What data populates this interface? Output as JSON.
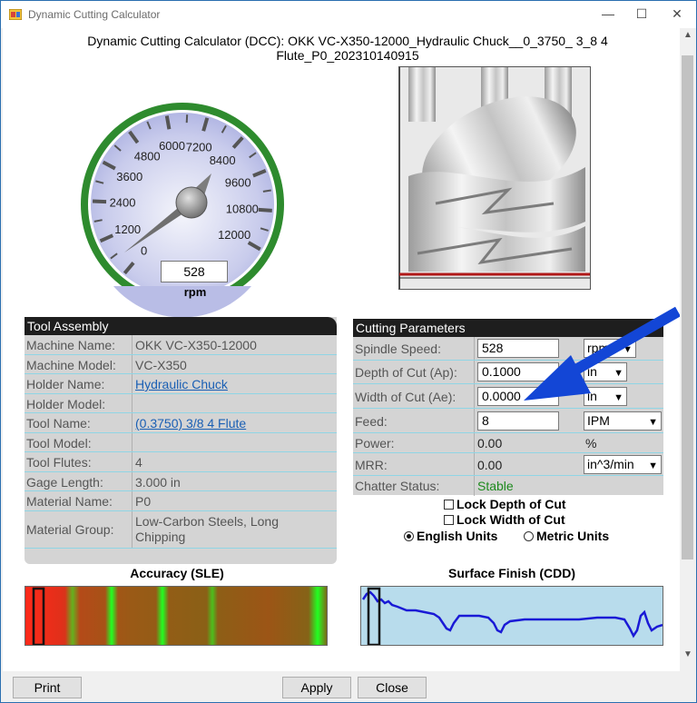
{
  "window": {
    "title": "Dynamic Cutting Calculator"
  },
  "header": {
    "title_line1": "Dynamic Cutting Calculator (DCC): OKK VC-X350-12000_Hydraulic Chuck__0_3750_ 3_8 4",
    "title_line2": "Flute_P0_202310140915"
  },
  "gauge": {
    "ticks": [
      "0",
      "1200",
      "2400",
      "3600",
      "4800",
      "6000",
      "7200",
      "8400",
      "9600",
      "10800",
      "12000"
    ],
    "value": "528",
    "needle_rpm": 528,
    "max_rpm": 12000,
    "unit": "rpm"
  },
  "tool_assembly": {
    "heading": "Tool Assembly",
    "rows": [
      {
        "label": "Machine Name:",
        "value": "OKK VC-X350-12000",
        "link": false
      },
      {
        "label": "Machine Model:",
        "value": "VC-X350",
        "link": false
      },
      {
        "label": "Holder Name:",
        "value": "Hydraulic Chuck",
        "link": true
      },
      {
        "label": "Holder Model:",
        "value": "",
        "link": false
      },
      {
        "label": "Tool Name:",
        "value": "(0.3750) 3/8 4 Flute",
        "link": true
      },
      {
        "label": "Tool Model:",
        "value": "",
        "link": false
      },
      {
        "label": "Tool Flutes:",
        "value": "4",
        "link": false
      },
      {
        "label": "Gage Length:",
        "value": "3.000 in",
        "link": false
      },
      {
        "label": "Material Name:",
        "value": "P0",
        "link": false
      },
      {
        "label": "Material Group:",
        "value": "Low-Carbon Steels, Long Chipping",
        "link": false
      }
    ]
  },
  "cutting": {
    "heading": "Cutting Parameters",
    "spindle_label": "Spindle Speed:",
    "spindle_value": "528",
    "spindle_unit": "rpm",
    "doc_label": "Depth of Cut (Ap):",
    "doc_value": "0.1000",
    "doc_unit": "in",
    "woc_label": "Width of Cut (Ae):",
    "woc_value": "0.0000",
    "woc_unit": "in",
    "feed_label": "Feed:",
    "feed_value": "8",
    "feed_unit": "IPM",
    "power_label": "Power:",
    "power_value": "0.00",
    "power_unit": "%",
    "mrr_label": "MRR:",
    "mrr_value": "0.00",
    "mrr_unit": "in^3/min",
    "chatter_label": "Chatter Status:",
    "chatter_value": "Stable"
  },
  "options": {
    "lock_depth": "Lock Depth of Cut",
    "lock_width": "Lock Width of Cut",
    "english": "English Units",
    "metric": "Metric Units"
  },
  "accuracy": {
    "title": "Accuracy (SLE)"
  },
  "surface": {
    "title": "Surface Finish (CDD)"
  },
  "buttons": {
    "print": "Print",
    "apply": "Apply",
    "close": "Close"
  },
  "colors": {
    "gauge_rim": "#2e8b2e",
    "gauge_face": "#b9bde6",
    "panel_head": "#1e1e1e",
    "row_border": "#8fd5e5",
    "arrow": "#1346d6",
    "stable": "#1e8a1e"
  }
}
